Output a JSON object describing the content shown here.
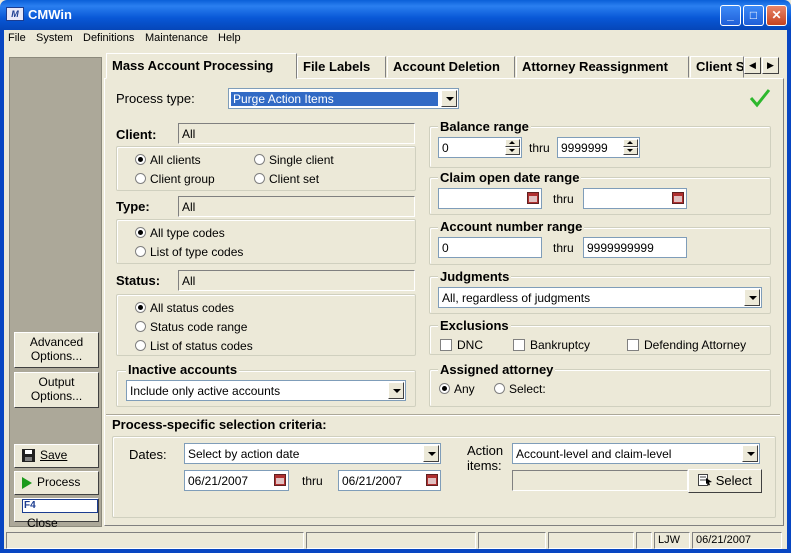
{
  "window": {
    "title": "CMWin",
    "icon_text": "M"
  },
  "menu": [
    "File",
    "System",
    "Definitions",
    "Maintenance",
    "Help"
  ],
  "sidebar": {
    "advanced": [
      "Advanced",
      "Options..."
    ],
    "output": [
      "Output",
      "Options..."
    ],
    "save": "Save",
    "process": "Process",
    "close": "Close",
    "close_key": "F4"
  },
  "tabs": [
    "Mass Account Processing",
    "File Labels",
    "Account Deletion",
    "Attorney Reassignment",
    "Client S"
  ],
  "process_type": {
    "label": "Process type:",
    "value": "Purge Action Items"
  },
  "client": {
    "label": "Client:",
    "value": "All",
    "options": [
      "All clients",
      "Single client",
      "Client group",
      "Client set"
    ]
  },
  "type": {
    "label": "Type:",
    "value": "All",
    "options": [
      "All type codes",
      "List of type codes"
    ]
  },
  "status": {
    "label": "Status:",
    "value": "All",
    "options": [
      "All status codes",
      "Status code range",
      "List of status codes"
    ]
  },
  "inactive": {
    "title": "Inactive accounts",
    "value": "Include only active accounts"
  },
  "balance": {
    "title": "Balance range",
    "from": "0",
    "thru_label": "thru",
    "to": "9999999"
  },
  "claim_date": {
    "title": "Claim open date range",
    "thru_label": "thru"
  },
  "account_number": {
    "title": "Account number range",
    "from": "0",
    "thru_label": "thru",
    "to": "9999999999"
  },
  "judgments": {
    "title": "Judgments",
    "value": "All, regardless of judgments"
  },
  "exclusions": {
    "title": "Exclusions",
    "items": [
      "DNC",
      "Bankruptcy",
      "Defending Attorney"
    ]
  },
  "assigned_attorney": {
    "title": "Assigned attorney",
    "options": [
      "Any",
      "Select:"
    ]
  },
  "criteria": {
    "title": "Process-specific selection criteria:",
    "dates_label": "Dates:",
    "dates_value": "Select by action date",
    "date_from": "06/21/2007",
    "thru_label": "thru",
    "date_to": "06/21/2007",
    "action_items_label": [
      "Action",
      "items:"
    ],
    "action_items_value": "Account-level and claim-level",
    "select_button": "Select"
  },
  "statusbar": {
    "user": "LJW",
    "date": "06/21/2007"
  },
  "colors": {
    "titlebar": "#0a5fd8",
    "selection": "#316ac5",
    "check": "#2db82d"
  }
}
